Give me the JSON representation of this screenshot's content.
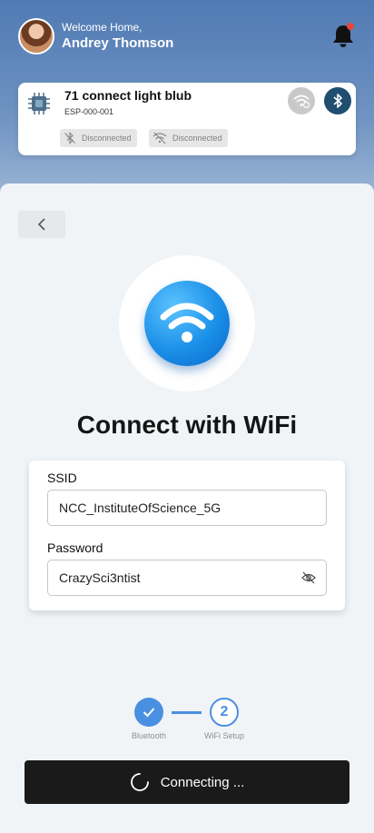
{
  "header": {
    "greeting": "Welcome Home,",
    "user_name": "Andrey Thomson",
    "avatar": "user-avatar-photo",
    "notification_icon": "bell-icon",
    "notification_dot_color": "#e8453c"
  },
  "device": {
    "name": "71 connect light blub",
    "id": "ESP-000-001",
    "icon": "chip-icon",
    "status_bluetooth": "Disconnected",
    "status_wifi": "Disconnected",
    "wifi_button_icon": "wifi-settings-icon",
    "bluetooth_button_icon": "bluetooth-icon"
  },
  "sheet": {
    "back_icon": "chevron-left-icon",
    "hero_icon": "wifi-icon",
    "title": "Connect with WiFi",
    "form": {
      "ssid_label": "SSID",
      "ssid_value": "NCC_InstituteOfScience_5G",
      "password_label": "Password",
      "password_value": "CrazySci3ntist",
      "password_toggle_icon": "eye-off-icon"
    },
    "steps": [
      {
        "label": "Bluetooth",
        "state": "completed",
        "icon": "check-icon"
      },
      {
        "label": "WiFi Setup",
        "state": "current",
        "number": "2"
      }
    ],
    "connect_button": "Connecting ...",
    "spinner_icon": "loading-spinner-icon"
  },
  "colors": {
    "accent": "#4a90e2",
    "bluetooth_button": "#1f4e70",
    "primary_button": "#1a1a1a"
  }
}
